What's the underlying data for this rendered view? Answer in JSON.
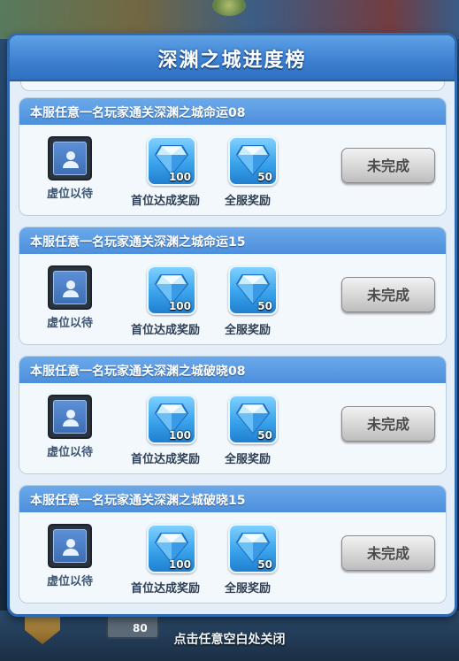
{
  "dialog": {
    "title": "深渊之城进度榜"
  },
  "close_hint": "点击任意空白处关闭",
  "background_item_count": "80",
  "cards": [
    {
      "title": "本服任意一名玩家通关深渊之城命运08",
      "avatar_label": "虚位以待",
      "first_reward": {
        "icon": "blue-diamond-icon",
        "count": "100",
        "label": "首位达成奖励"
      },
      "server_reward": {
        "icon": "blue-diamond-icon",
        "count": "50",
        "label": "全服奖励"
      },
      "status": "未完成"
    },
    {
      "title": "本服任意一名玩家通关深渊之城命运15",
      "avatar_label": "虚位以待",
      "first_reward": {
        "icon": "blue-diamond-icon",
        "count": "100",
        "label": "首位达成奖励"
      },
      "server_reward": {
        "icon": "blue-diamond-icon",
        "count": "50",
        "label": "全服奖励"
      },
      "status": "未完成"
    },
    {
      "title": "本服任意一名玩家通关深渊之城破晓08",
      "avatar_label": "虚位以待",
      "first_reward": {
        "icon": "blue-diamond-icon",
        "count": "100",
        "label": "首位达成奖励"
      },
      "server_reward": {
        "icon": "blue-diamond-icon",
        "count": "50",
        "label": "全服奖励"
      },
      "status": "未完成"
    },
    {
      "title": "本服任意一名玩家通关深渊之城破晓15",
      "avatar_label": "虚位以待",
      "first_reward": {
        "icon": "blue-diamond-icon",
        "count": "100",
        "label": "首位达成奖励"
      },
      "server_reward": {
        "icon": "blue-diamond-icon",
        "count": "50",
        "label": "全服奖励"
      },
      "status": "未完成"
    }
  ],
  "colors": {
    "header_blue": "#3f82d2",
    "card_head_blue": "#4d8fdc",
    "button_gray": "#d6d6d6"
  }
}
